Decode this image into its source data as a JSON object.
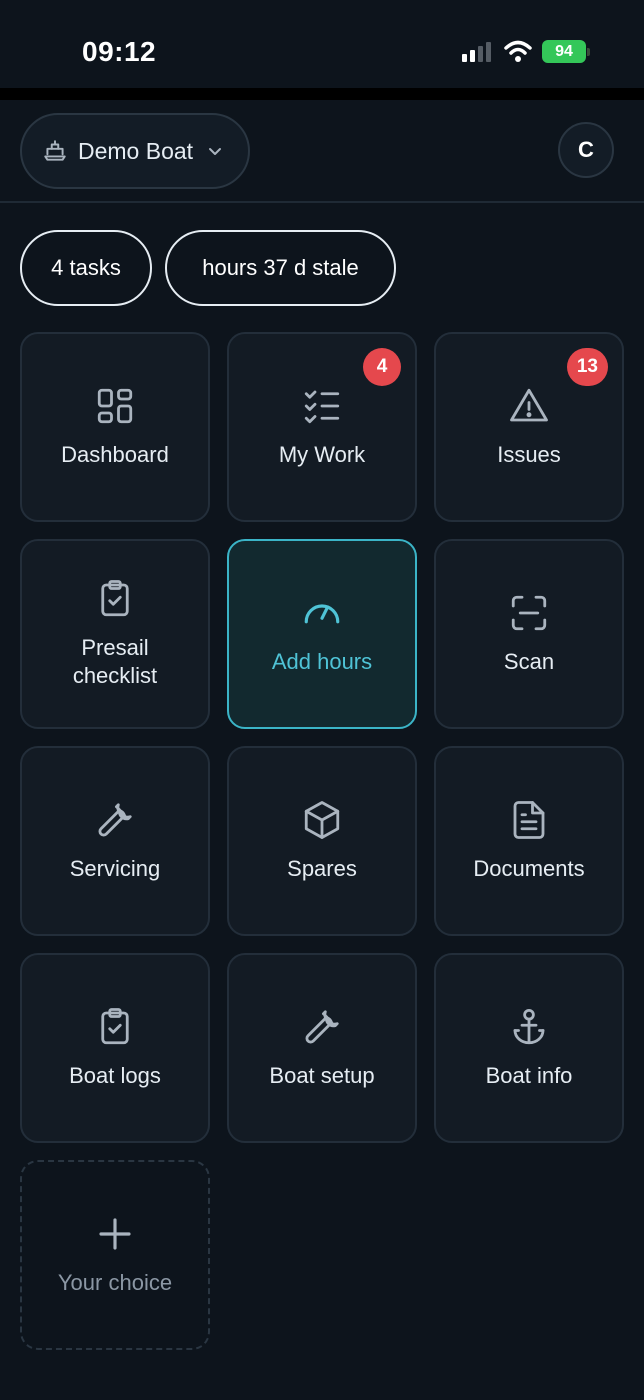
{
  "status_bar": {
    "time": "09:12",
    "battery": "94",
    "battery_color": "#34c759"
  },
  "header": {
    "boat_name": "Demo Boat",
    "avatar_initial": "C"
  },
  "chips": {
    "tasks": "4 tasks",
    "hours": "hours 37 d stale"
  },
  "tiles": [
    {
      "label": "Dashboard",
      "icon": "grid-icon"
    },
    {
      "label": "My Work",
      "icon": "checklist-icon",
      "badge": "4"
    },
    {
      "label": "Issues",
      "icon": "warning-icon",
      "badge": "13"
    },
    {
      "label": "Presail\nchecklist",
      "icon": "clipboard-check-icon"
    },
    {
      "label": "Add hours",
      "icon": "gauge-icon",
      "active": true
    },
    {
      "label": "Scan",
      "icon": "scan-icon"
    },
    {
      "label": "Servicing",
      "icon": "wrench-icon"
    },
    {
      "label": "Spares",
      "icon": "box-icon"
    },
    {
      "label": "Documents",
      "icon": "document-icon"
    },
    {
      "label": "Boat logs",
      "icon": "clipboard-check-icon"
    },
    {
      "label": "Boat setup",
      "icon": "wrench-icon"
    },
    {
      "label": "Boat info",
      "icon": "anchor-icon"
    },
    {
      "label": "Your choice",
      "icon": "plus-icon",
      "placeholder": true
    }
  ],
  "colors": {
    "accent": "#4fc3d6",
    "badge": "#e5484d",
    "background": "#0d141c"
  }
}
